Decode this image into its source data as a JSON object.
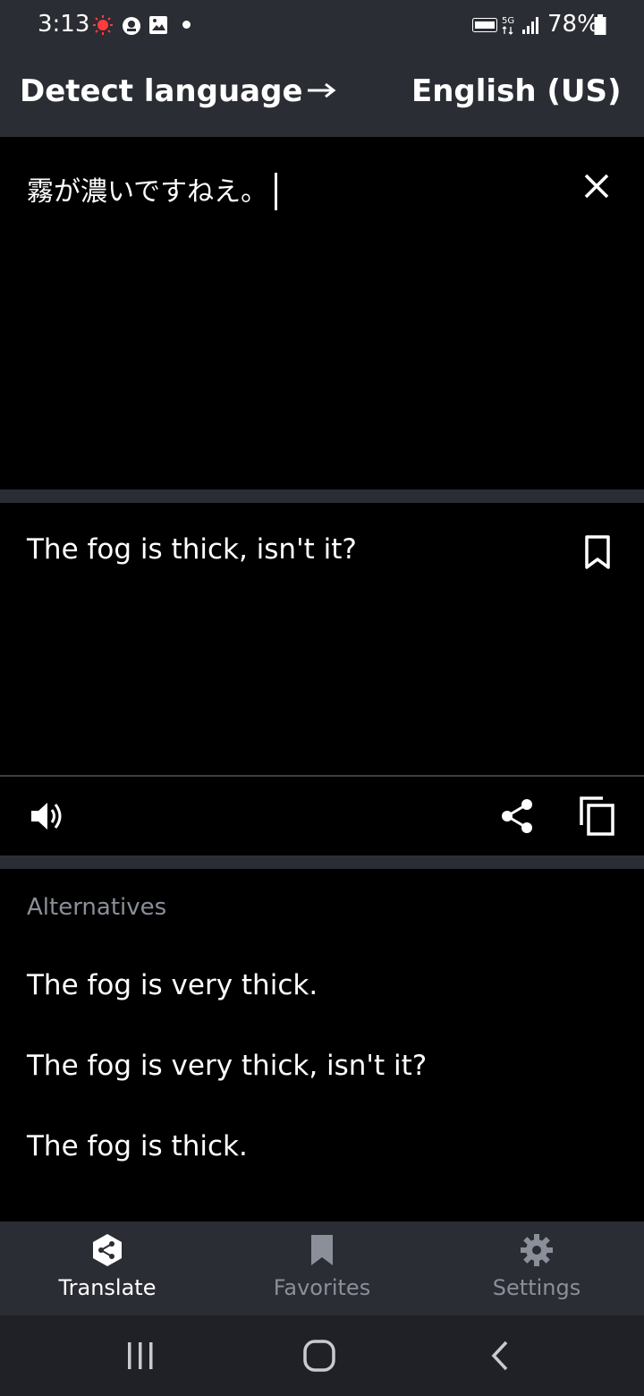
{
  "status_bar": {
    "time": "3:13",
    "battery": "78%",
    "icons": [
      "recording-icon",
      "assistant-icon",
      "image-icon",
      "notification-dot",
      "volte-icon",
      "5g-icon",
      "signal-icon",
      "battery-icon"
    ]
  },
  "header": {
    "source_language": "Detect language",
    "target_language": "English (US)",
    "arrow_icon": "arrow-right-icon"
  },
  "input": {
    "text": "霧が濃いですねえ。",
    "clear_icon": "close-icon"
  },
  "output": {
    "text": "The fog is thick, isn't it?",
    "bookmark_icon": "bookmark-icon"
  },
  "actions": {
    "speak_icon": "speaker-icon",
    "share_icon": "share-icon",
    "copy_icon": "copy-icon"
  },
  "alternatives": {
    "heading": "Alternatives",
    "items": [
      "The fog is very thick.",
      "The fog is very thick, isn't it?",
      "The fog is thick."
    ]
  },
  "bottom_nav": {
    "items": [
      {
        "label": "Translate",
        "icon": "translate-icon",
        "active": true
      },
      {
        "label": "Favorites",
        "icon": "bookmark-icon",
        "active": false
      },
      {
        "label": "Settings",
        "icon": "gear-icon",
        "active": false
      }
    ]
  },
  "system_nav": {
    "icons": [
      "recent-apps-icon",
      "home-icon",
      "back-icon"
    ]
  },
  "colors": {
    "bar_background": "#2a2d33",
    "content_background": "#000000",
    "inactive_text": "#8a8f99",
    "active_text": "#ffffff"
  }
}
